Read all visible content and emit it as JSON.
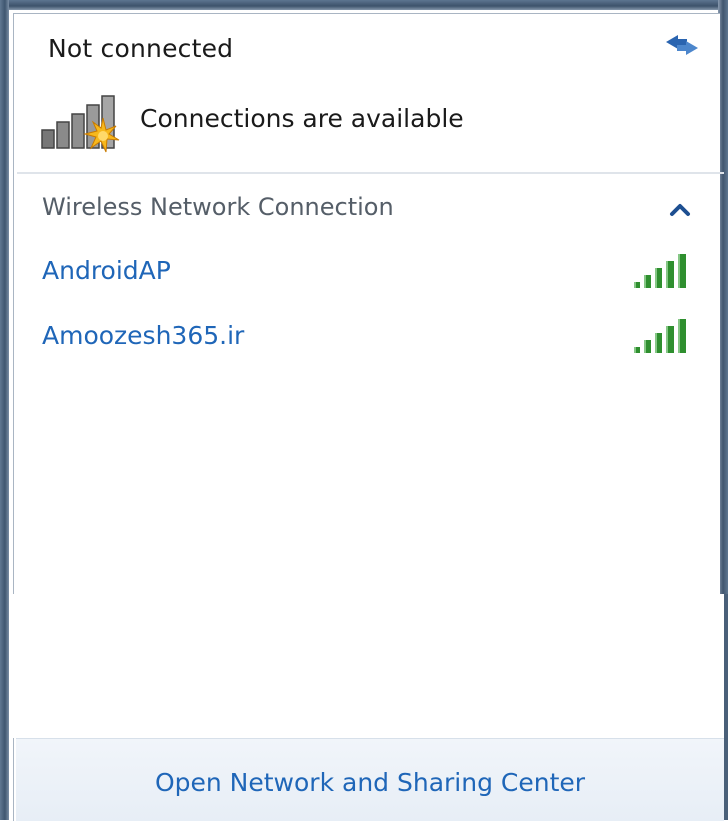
{
  "header": {
    "connection_status": "Not connected",
    "availability_text": "Connections are available"
  },
  "section": {
    "title": "Wireless Network Connection"
  },
  "networks": [
    {
      "name": "AndroidAP",
      "signal_bars": 5
    },
    {
      "name": "Amoozesh365.ir",
      "signal_bars": 5
    }
  ],
  "footer": {
    "link_label": "Open Network and Sharing Center"
  },
  "icons": {
    "refresh": "refresh-icon",
    "status": "network-status-icon",
    "collapse": "chevron-up-icon",
    "signal": "wifi-signal-icon"
  },
  "colors": {
    "link": "#1f66b8",
    "signal_green": "#2f8f2f",
    "footer_bg": "#e9f0f7"
  }
}
